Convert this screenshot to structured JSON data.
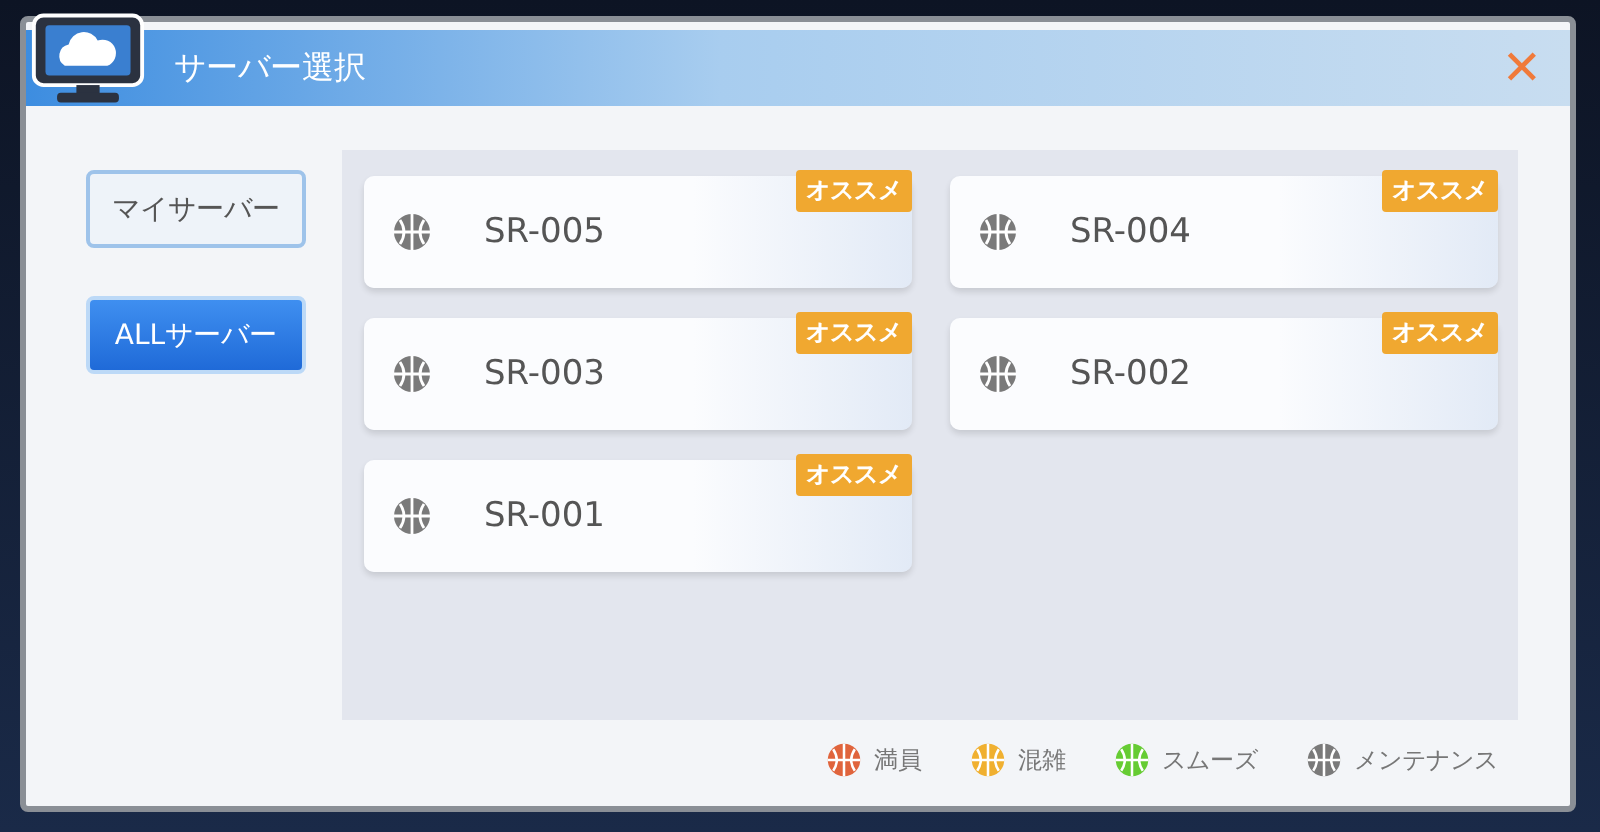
{
  "window": {
    "title": "サーバー選択",
    "close": "✕"
  },
  "tabs": [
    {
      "label": "マイサーバー",
      "selected": false
    },
    {
      "label": "ALLサーバー",
      "selected": true
    }
  ],
  "servers": [
    {
      "name": "SR-005",
      "badge": "オススメ",
      "color": "#7a7a7a"
    },
    {
      "name": "SR-004",
      "badge": "オススメ",
      "color": "#7a7a7a"
    },
    {
      "name": "SR-003",
      "badge": "オススメ",
      "color": "#7a7a7a"
    },
    {
      "name": "SR-002",
      "badge": "オススメ",
      "color": "#7a7a7a"
    },
    {
      "name": "SR-001",
      "badge": "オススメ",
      "color": "#7a7a7a"
    }
  ],
  "legend": [
    {
      "label": "満員",
      "color": "#e0643c"
    },
    {
      "label": "混雑",
      "color": "#f0b030"
    },
    {
      "label": "スムーズ",
      "color": "#66cc33"
    },
    {
      "label": "メンテナンス",
      "color": "#7a7a7a"
    }
  ]
}
